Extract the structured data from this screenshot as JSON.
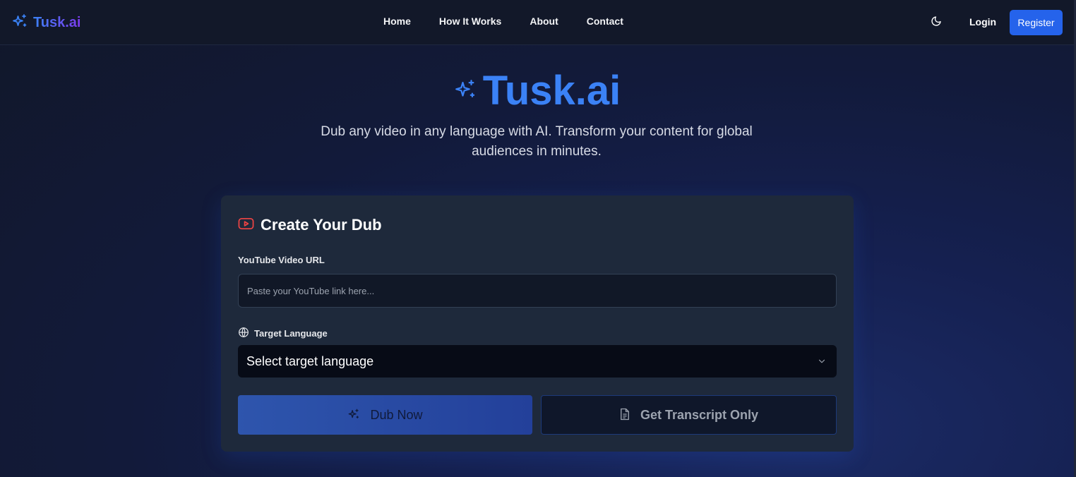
{
  "colors": {
    "accent": "#3b82f6",
    "brand_gradient_start": "#3b82f6",
    "brand_gradient_end": "#7c3aed",
    "register_bg": "#2563eb",
    "youtube_icon": "#ef4444",
    "card_bg": "#1e293b",
    "navbar_bg": "#121829"
  },
  "navbar": {
    "brand": "Tusk.ai",
    "brand_icon": "sparkles-icon",
    "links": [
      "Home",
      "How It Works",
      "About",
      "Contact"
    ],
    "theme_icon": "moon-icon",
    "login_label": "Login",
    "register_label": "Register"
  },
  "hero": {
    "title": "Tusk.ai",
    "title_icon": "sparkles-icon",
    "subtitle": "Dub any video in any language with AI. Transform your content for global audiences in minutes."
  },
  "card": {
    "title": "Create Your Dub",
    "title_icon": "youtube-icon",
    "url_label": "YouTube Video URL",
    "url_placeholder": "Paste your YouTube link here...",
    "url_value": "",
    "language_label": "Target Language",
    "language_icon": "globe-icon",
    "language_selected": "Select target language",
    "dub_button_label": "Dub Now",
    "dub_button_icon": "sparkles-icon",
    "transcript_button_label": "Get Transcript Only",
    "transcript_button_icon": "document-icon"
  }
}
